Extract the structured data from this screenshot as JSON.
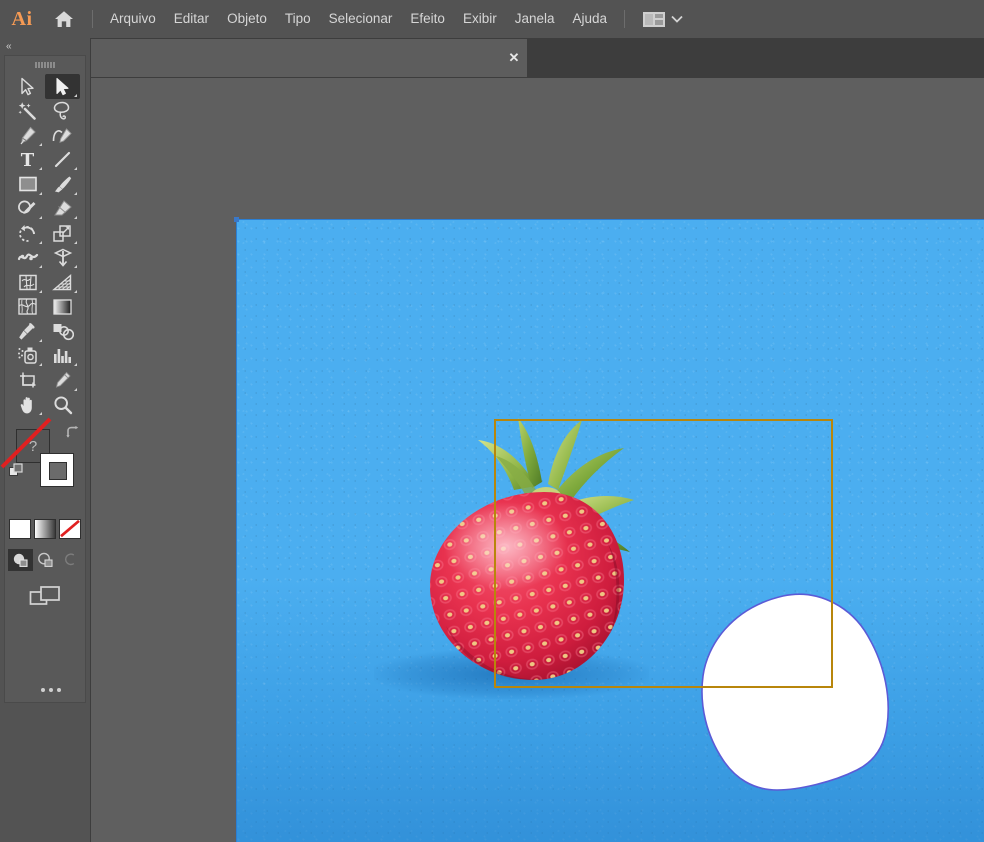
{
  "app": {
    "name": "Adobe Illustrator",
    "logo_text": "Ai",
    "accent_color": "#f59a54",
    "chrome_color": "#535353",
    "canvas_color": "#5f5f5f"
  },
  "menubar": {
    "home_icon": "home-icon",
    "items": [
      {
        "label": "Arquivo"
      },
      {
        "label": "Editar"
      },
      {
        "label": "Objeto"
      },
      {
        "label": "Tipo"
      },
      {
        "label": "Selecionar"
      },
      {
        "label": "Efeito"
      },
      {
        "label": "Exibir"
      },
      {
        "label": "Janela"
      },
      {
        "label": "Ajuda"
      }
    ],
    "workspace_switcher": {
      "icon": "workspace-grid-icon",
      "chevron": "chevron-down-icon",
      "label": ""
    }
  },
  "tabbar": {
    "document_tab": {
      "title": "",
      "close_label": "✕",
      "active": true
    }
  },
  "toolbar": {
    "collapse_icon": "double-chevron-left-icon",
    "collapse_label": "«",
    "grip": "drag-grip",
    "tools": [
      {
        "name": "direct-selection-tool",
        "label": "Seleção Direta",
        "active": false,
        "has_flyout": false
      },
      {
        "name": "selection-tool",
        "label": "Seleção",
        "active": true,
        "has_flyout": true
      },
      {
        "name": "magic-wand-tool",
        "label": "Varinha Mágica",
        "active": false,
        "has_flyout": false
      },
      {
        "name": "lasso-tool",
        "label": "Laço",
        "active": false,
        "has_flyout": false
      },
      {
        "name": "pen-tool",
        "label": "Caneta",
        "active": false,
        "has_flyout": true
      },
      {
        "name": "curvature-tool",
        "label": "Curvatura",
        "active": false,
        "has_flyout": false
      },
      {
        "name": "type-tool",
        "label": "Texto",
        "active": false,
        "has_flyout": true
      },
      {
        "name": "line-segment-tool",
        "label": "Segmento de Linha",
        "active": false,
        "has_flyout": true
      },
      {
        "name": "rectangle-tool",
        "label": "Retângulo",
        "active": false,
        "has_flyout": true
      },
      {
        "name": "paintbrush-tool",
        "label": "Pincel",
        "active": false,
        "has_flyout": true
      },
      {
        "name": "shaper-tool",
        "label": "Shaper",
        "active": false,
        "has_flyout": true
      },
      {
        "name": "eraser-tool",
        "label": "Borracha",
        "active": false,
        "has_flyout": true
      },
      {
        "name": "rotate-tool",
        "label": "Girar",
        "active": false,
        "has_flyout": true
      },
      {
        "name": "scale-tool",
        "label": "Escala",
        "active": false,
        "has_flyout": true
      },
      {
        "name": "width-tool",
        "label": "Largura",
        "active": false,
        "has_flyout": true
      },
      {
        "name": "free-transform-tool",
        "label": "Transformação Livre",
        "active": false,
        "has_flyout": true
      },
      {
        "name": "shape-builder-tool",
        "label": "Criador de Formas",
        "active": false,
        "has_flyout": true
      },
      {
        "name": "perspective-grid-tool",
        "label": "Grade de Perspectiva",
        "active": false,
        "has_flyout": true
      },
      {
        "name": "mesh-tool",
        "label": "Malha",
        "active": false,
        "has_flyout": false
      },
      {
        "name": "gradient-tool",
        "label": "Degradê",
        "active": false,
        "has_flyout": false
      },
      {
        "name": "eyedropper-tool",
        "label": "Conta-gotas",
        "active": false,
        "has_flyout": true
      },
      {
        "name": "blend-tool",
        "label": "Mistura",
        "active": false,
        "has_flyout": false
      },
      {
        "name": "symbol-sprayer-tool",
        "label": "Pulverizador de Símbolos",
        "active": false,
        "has_flyout": true
      },
      {
        "name": "column-graph-tool",
        "label": "Gráfico de Colunas",
        "active": false,
        "has_flyout": true
      },
      {
        "name": "artboard-tool",
        "label": "Prancheta",
        "active": false,
        "has_flyout": false
      },
      {
        "name": "slice-tool",
        "label": "Fatia",
        "active": false,
        "has_flyout": true
      },
      {
        "name": "hand-tool",
        "label": "Mão",
        "active": false,
        "has_flyout": true
      },
      {
        "name": "zoom-tool",
        "label": "Zoom",
        "active": false,
        "has_flyout": false
      }
    ],
    "color_controls": {
      "fill_swatch": {
        "name": "fill-color-swatch",
        "value": "?",
        "color": "#555555"
      },
      "stroke_swatch": {
        "name": "stroke-color-swatch",
        "color": "#ffffff",
        "is_none": true
      },
      "swap_icon": "swap-fill-stroke-icon",
      "default_icon": "default-fill-stroke-icon",
      "modes": [
        {
          "name": "color-mode-button",
          "label": "Cor",
          "type": "solid"
        },
        {
          "name": "gradient-mode-button",
          "label": "Degradê",
          "type": "gradient"
        },
        {
          "name": "none-mode-button",
          "label": "Nenhum",
          "type": "none"
        }
      ]
    },
    "draw_modes": [
      {
        "name": "draw-normal-button",
        "label": "Desenhar Normal",
        "active": true,
        "disabled": false
      },
      {
        "name": "draw-behind-button",
        "label": "Desenhar Atrás",
        "active": false,
        "disabled": false
      },
      {
        "name": "draw-inside-button",
        "label": "Desenhar Dentro",
        "active": false,
        "disabled": true
      }
    ],
    "screen_mode": {
      "name": "change-screen-mode-button",
      "label": "Alterar Modo de Tela"
    },
    "more_tools": {
      "name": "edit-toolbar-button",
      "label": "Editar barra de ferramentas"
    }
  },
  "canvas": {
    "artboard": {
      "background_color": "#4baef0",
      "edge_color": "#2b7fd4",
      "anchor_color": "#3a78c8"
    },
    "artwork": {
      "photo_subject": "strawberry-photo",
      "description": "Morango sobre fundo azul"
    },
    "selection": {
      "bounding_box_color": "#b8860b",
      "shape_name": "white-blob-path",
      "fill_color": "#ffffff",
      "stroke_color": "#5b5bd6"
    }
  }
}
